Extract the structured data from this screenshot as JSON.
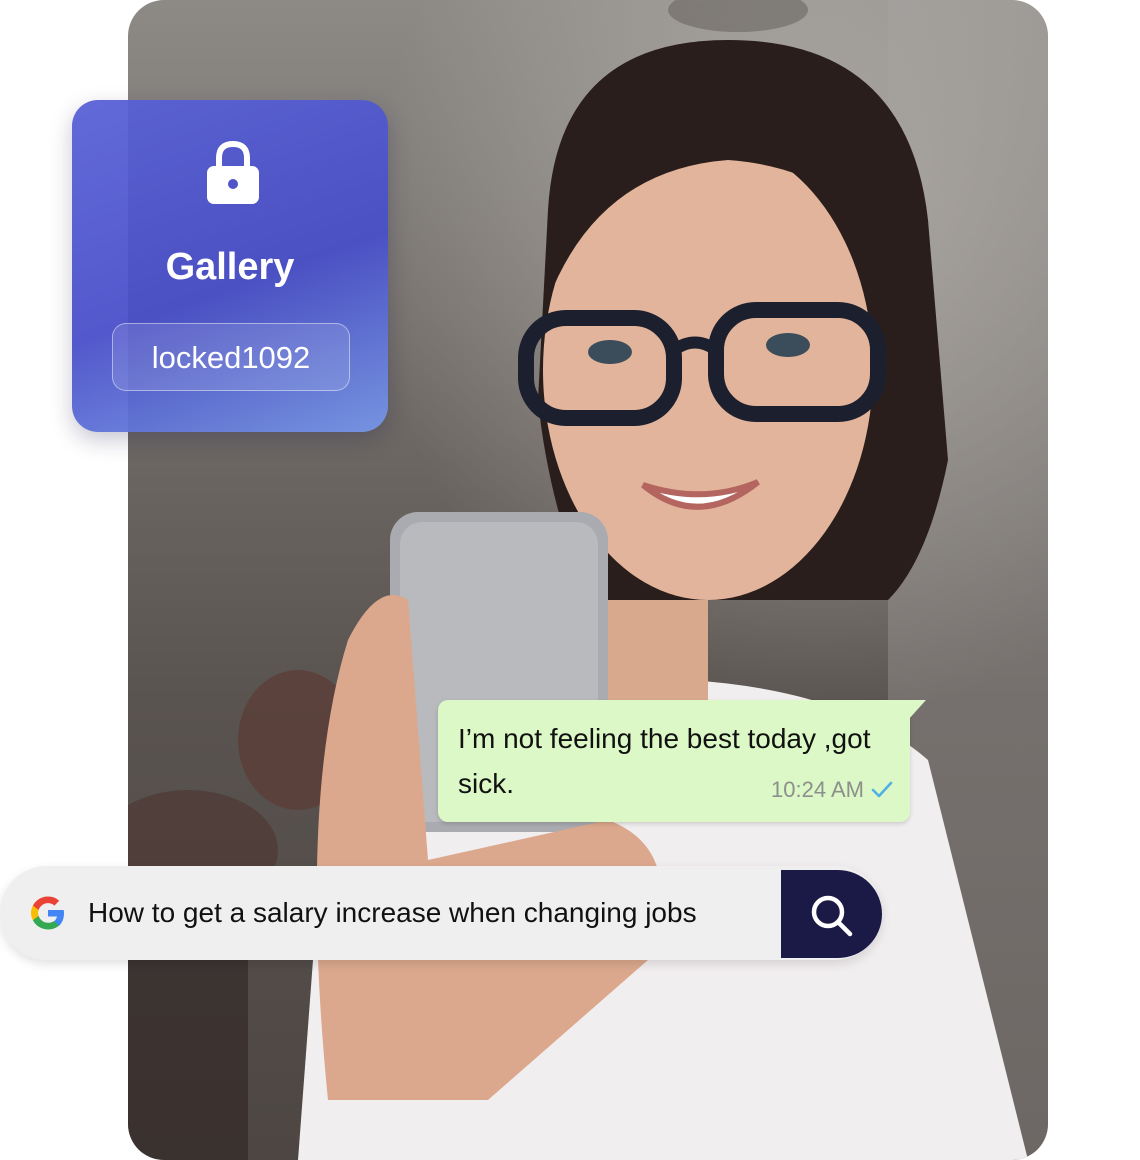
{
  "gallery": {
    "title": "Gallery",
    "pin": "locked1092",
    "icon": "lock-icon"
  },
  "chat": {
    "message": "I’m not feeling the best today ,got sick.",
    "time": "10:24  AM",
    "status_icon": "check-icon",
    "bubble_color": "#dcf8c6"
  },
  "search": {
    "query": "How to get a salary increase when changing jobs",
    "provider_icon": "google-icon",
    "button_icon": "search-icon",
    "button_color": "#1b1a46"
  }
}
